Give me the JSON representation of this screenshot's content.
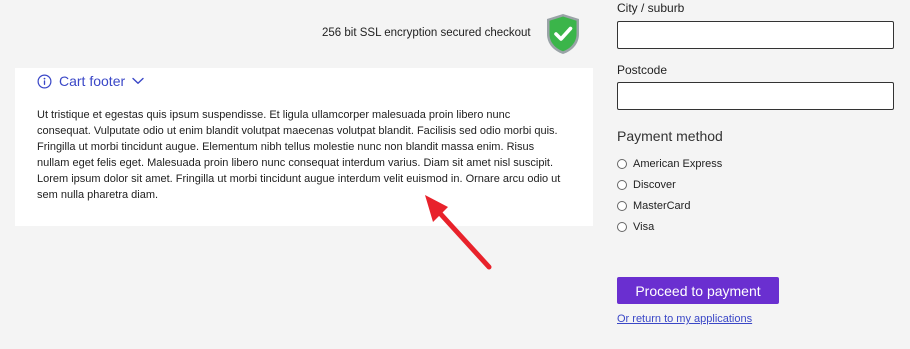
{
  "security": {
    "ssl_text": "256 bit SSL encryption secured checkout",
    "badge_icon": "shield-check-icon",
    "badge_color": "#3bb54a"
  },
  "cart_footer": {
    "toggle_label": "Cart footer",
    "info_icon": "info-icon",
    "chevron_icon": "chevron-down-icon",
    "body": "Ut tristique et egestas quis ipsum suspendisse. Et ligula ullamcorper malesuada proin libero nunc consequat. Vulputate odio ut enim blandit volutpat maecenas volutpat blandit. Facilisis sed odio morbi quis. Fringilla ut morbi tincidunt augue. Elementum nibh tellus molestie nunc non blandit massa enim. Risus nullam eget felis eget. Malesuada proin libero nunc consequat interdum varius. Diam sit amet nisl suscipit. Lorem ipsum dolor sit amet. Fringilla ut morbi tincidunt augue interdum velit euismod in. Ornare arcu odio ut sem nulla pharetra diam."
  },
  "form": {
    "city_label": "City / suburb",
    "city_value": "",
    "postcode_label": "Postcode",
    "postcode_value": "",
    "payment_title": "Payment method",
    "payment_options": [
      "American Express",
      "Discover",
      "MasterCard",
      "Visa"
    ],
    "proceed_label": "Proceed to payment",
    "return_label": "Or return to my applications"
  },
  "annotation": {
    "arrow_icon": "red-arrow-icon",
    "arrow_color": "#e8222b"
  },
  "colors": {
    "accent": "#6a2fd0",
    "link": "#3a47c7"
  }
}
